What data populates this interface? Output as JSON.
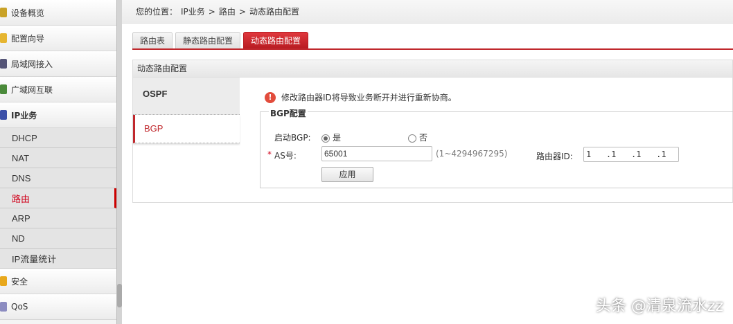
{
  "sidebar": {
    "items": [
      {
        "label": "设备概览",
        "color": "#c9a227"
      },
      {
        "label": "配置向导",
        "color": "#e6b530"
      },
      {
        "label": "局域网接入",
        "color": "#557"
      },
      {
        "label": "广域网互联",
        "color": "#4a8a3a"
      },
      {
        "label": "IP业务",
        "color": "#3b4fa8"
      }
    ],
    "sub": [
      "DHCP",
      "NAT",
      "DNS",
      "路由",
      "ARP",
      "ND",
      "IP流量统计"
    ],
    "bottom": [
      {
        "label": "安全",
        "color": "#e8a81c"
      },
      {
        "label": "QoS",
        "color": "#8c8cc0"
      }
    ]
  },
  "breadcrumb": {
    "prefix": "您的位置：",
    "items": [
      "IP业务",
      ">",
      "路由",
      ">",
      "动态路由配置"
    ]
  },
  "tabs": [
    "路由表",
    "静态路由配置",
    "动态路由配置"
  ],
  "panel": {
    "title": "动态路由配置",
    "vtabs": [
      "OSPF",
      "BGP"
    ],
    "warning": "修改路由器ID将导致业务断开并进行重新协商。",
    "fieldset": "BGP配置",
    "enable_label": "启动BGP:",
    "yes": "是",
    "no": "否",
    "required": "*",
    "as_label": "AS号:",
    "as_value": "65001",
    "as_hint": "(1~4294967295)",
    "router_id_label": "路由器ID:",
    "router_id": "1   .1   .1   .1",
    "apply": "应用"
  },
  "watermark": "头条 @清泉流水zz"
}
